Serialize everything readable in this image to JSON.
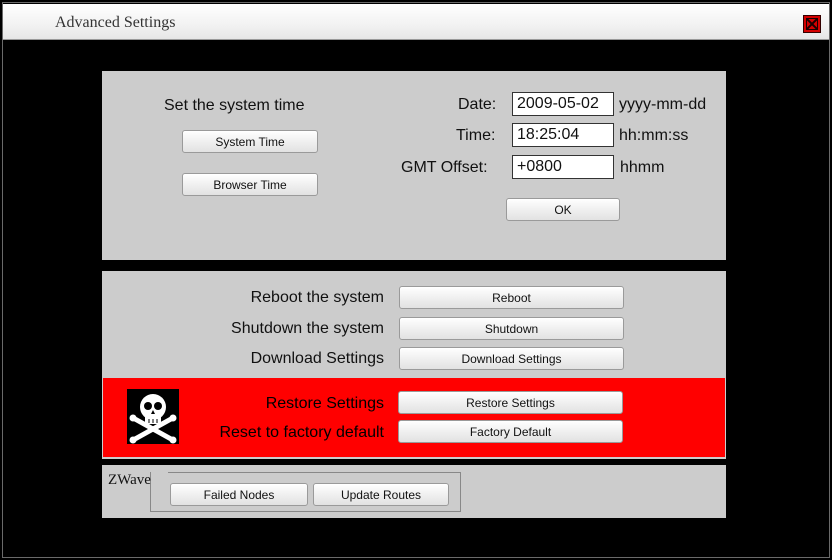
{
  "window": {
    "title": "Advanced Settings",
    "close_icon": "close-icon",
    "colors": {
      "danger": "#ff0000",
      "panel": "#cccccc",
      "background": "#000000"
    }
  },
  "time_section": {
    "heading": "Set the system time",
    "system_time_button": "System Time",
    "browser_time_button": "Browser Time",
    "date_label": "Date:",
    "date_value": "2009-05-02",
    "date_format": "yyyy-mm-dd",
    "time_label": "Time:",
    "time_value": "18:25:04",
    "time_format": "hh:mm:ss",
    "gmt_label": "GMT Offset:",
    "gmt_value": "+0800",
    "gmt_format": "hhmm",
    "ok_button": "OK"
  },
  "actions": {
    "reboot_label": "Reboot the system",
    "reboot_button": "Reboot",
    "shutdown_label": "Shutdown the system",
    "shutdown_button": "Shutdown",
    "download_label": "Download Settings",
    "download_button": "Download Settings"
  },
  "danger_zone": {
    "icon": "skull-crossbones-icon",
    "restore_label": "Restore Settings",
    "restore_button": "Restore Settings",
    "factory_label": "Reset to factory default",
    "factory_button": "Factory Default"
  },
  "zwave": {
    "legend": "ZWave",
    "failed_nodes_button": "Failed Nodes",
    "update_routes_button": "Update Routes"
  }
}
